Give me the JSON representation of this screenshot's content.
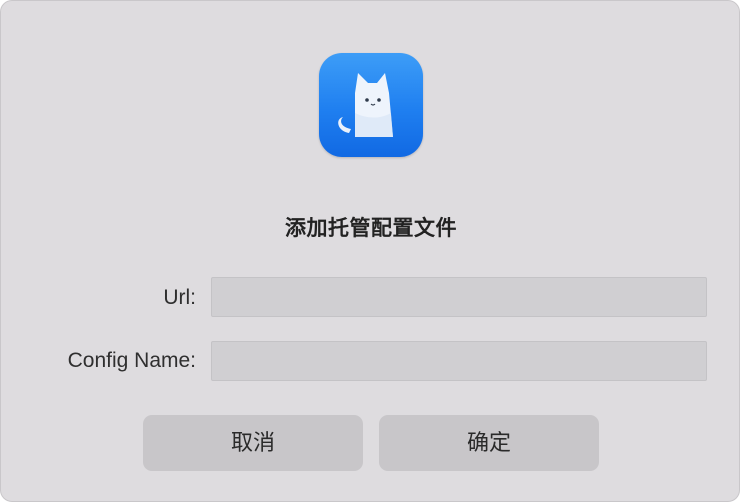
{
  "dialog": {
    "icon": "cat-app-icon",
    "title": "添加托管配置文件",
    "fields": {
      "url": {
        "label": "Url:",
        "value": "",
        "placeholder": ""
      },
      "config_name": {
        "label": "Config Name:",
        "value": "",
        "placeholder": ""
      }
    },
    "buttons": {
      "cancel": "取消",
      "confirm": "确定"
    }
  },
  "colors": {
    "dialog_background": "#dedcdf",
    "icon_blue": "#1f7ff0",
    "field_background": "#d0cfd2",
    "button_background": "#c8c6c9"
  }
}
